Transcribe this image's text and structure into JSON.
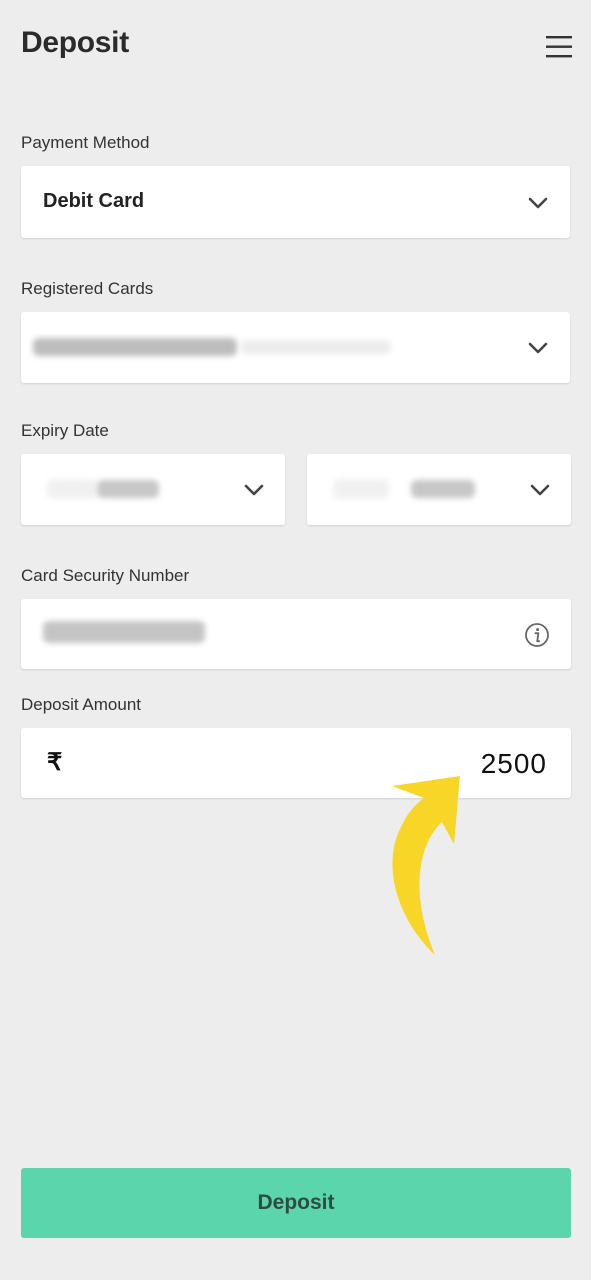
{
  "header": {
    "title": "Deposit",
    "menu_icon": "hamburger-menu-icon"
  },
  "form": {
    "payment_method": {
      "label": "Payment Method",
      "value": "Debit Card"
    },
    "registered_cards": {
      "label": "Registered Cards"
    },
    "expiry_date": {
      "label": "Expiry Date"
    },
    "card_security_number": {
      "label": "Card Security Number",
      "info_icon": "info-icon"
    },
    "deposit_amount": {
      "label": "Deposit Amount",
      "currency_symbol": "₹",
      "value": "2500"
    }
  },
  "submit": {
    "label": "Deposit"
  },
  "colors": {
    "background": "#ededed",
    "button": "#5bd6ac",
    "annotation_arrow": "#f7d628"
  }
}
